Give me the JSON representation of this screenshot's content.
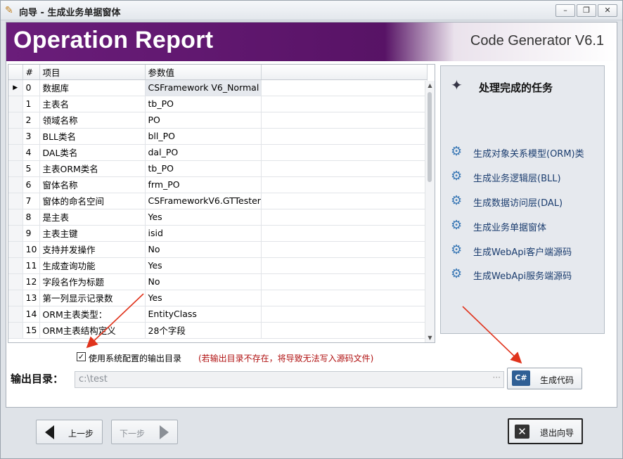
{
  "window": {
    "title": "向导 - 生成业务单据窗体",
    "minimize": "–",
    "restore": "❐",
    "close": "✕"
  },
  "banner": {
    "title": "Operation Report",
    "brand": "Code Generator V6.1"
  },
  "grid": {
    "columns": [
      "",
      "#",
      "项目",
      "参数值"
    ],
    "rows": [
      {
        "num": "0",
        "item": "数据库",
        "value": "CSFramework V6_Normal",
        "selected": true
      },
      {
        "num": "1",
        "item": "主表名",
        "value": "tb_PO"
      },
      {
        "num": "2",
        "item": "领域名称",
        "value": "PO"
      },
      {
        "num": "3",
        "item": "BLL类名",
        "value": "bll_PO"
      },
      {
        "num": "4",
        "item": "DAL类名",
        "value": "dal_PO"
      },
      {
        "num": "5",
        "item": "主表ORM类名",
        "value": "tb_PO"
      },
      {
        "num": "6",
        "item": "窗体名称",
        "value": "frm_PO"
      },
      {
        "num": "7",
        "item": "窗体的命名空间",
        "value": "CSFrameworkV6.GTTester"
      },
      {
        "num": "8",
        "item": "是主表",
        "value": "Yes"
      },
      {
        "num": "9",
        "item": "主表主键",
        "value": "isid"
      },
      {
        "num": "10",
        "item": "支持并发操作",
        "value": "No"
      },
      {
        "num": "11",
        "item": "生成查询功能",
        "value": "Yes"
      },
      {
        "num": "12",
        "item": "字段名作为标题",
        "value": "No"
      },
      {
        "num": "13",
        "item": "第一列显示记录数",
        "value": "Yes"
      },
      {
        "num": "14",
        "item": "ORM主表类型：",
        "value": "EntityClass"
      },
      {
        "num": "15",
        "item": "ORM主表结构定义",
        "value": "28个字段"
      }
    ]
  },
  "tasks": {
    "heading": "处理完成的任务",
    "items": [
      "生成对象关系模型(ORM)类",
      "生成业务逻辑层(BLL)",
      "生成数据访问层(DAL)",
      "生成业务单据窗体",
      "生成WebApi客户端源码",
      "生成WebApi服务端源码"
    ]
  },
  "output": {
    "checkbox_label": "使用系统配置的输出目录",
    "checkbox_checked": true,
    "checkbox_mark": "✓",
    "warning": "(若输出目录不存在，将导致无法写入源码文件)",
    "dir_label": "输出目录：",
    "dir_value": "c:\\test",
    "browse": "···",
    "generate_icon": "C#",
    "generate_label": "生成代码"
  },
  "nav": {
    "prev_label": "上一步",
    "next_label": "下一步",
    "exit_icon": "✕",
    "exit_label": "退出向导"
  },
  "colors": {
    "banner": "#5a1468",
    "accent_arrow": "#e0331c",
    "gear": "#3a78b5",
    "warning": "#b01010"
  }
}
